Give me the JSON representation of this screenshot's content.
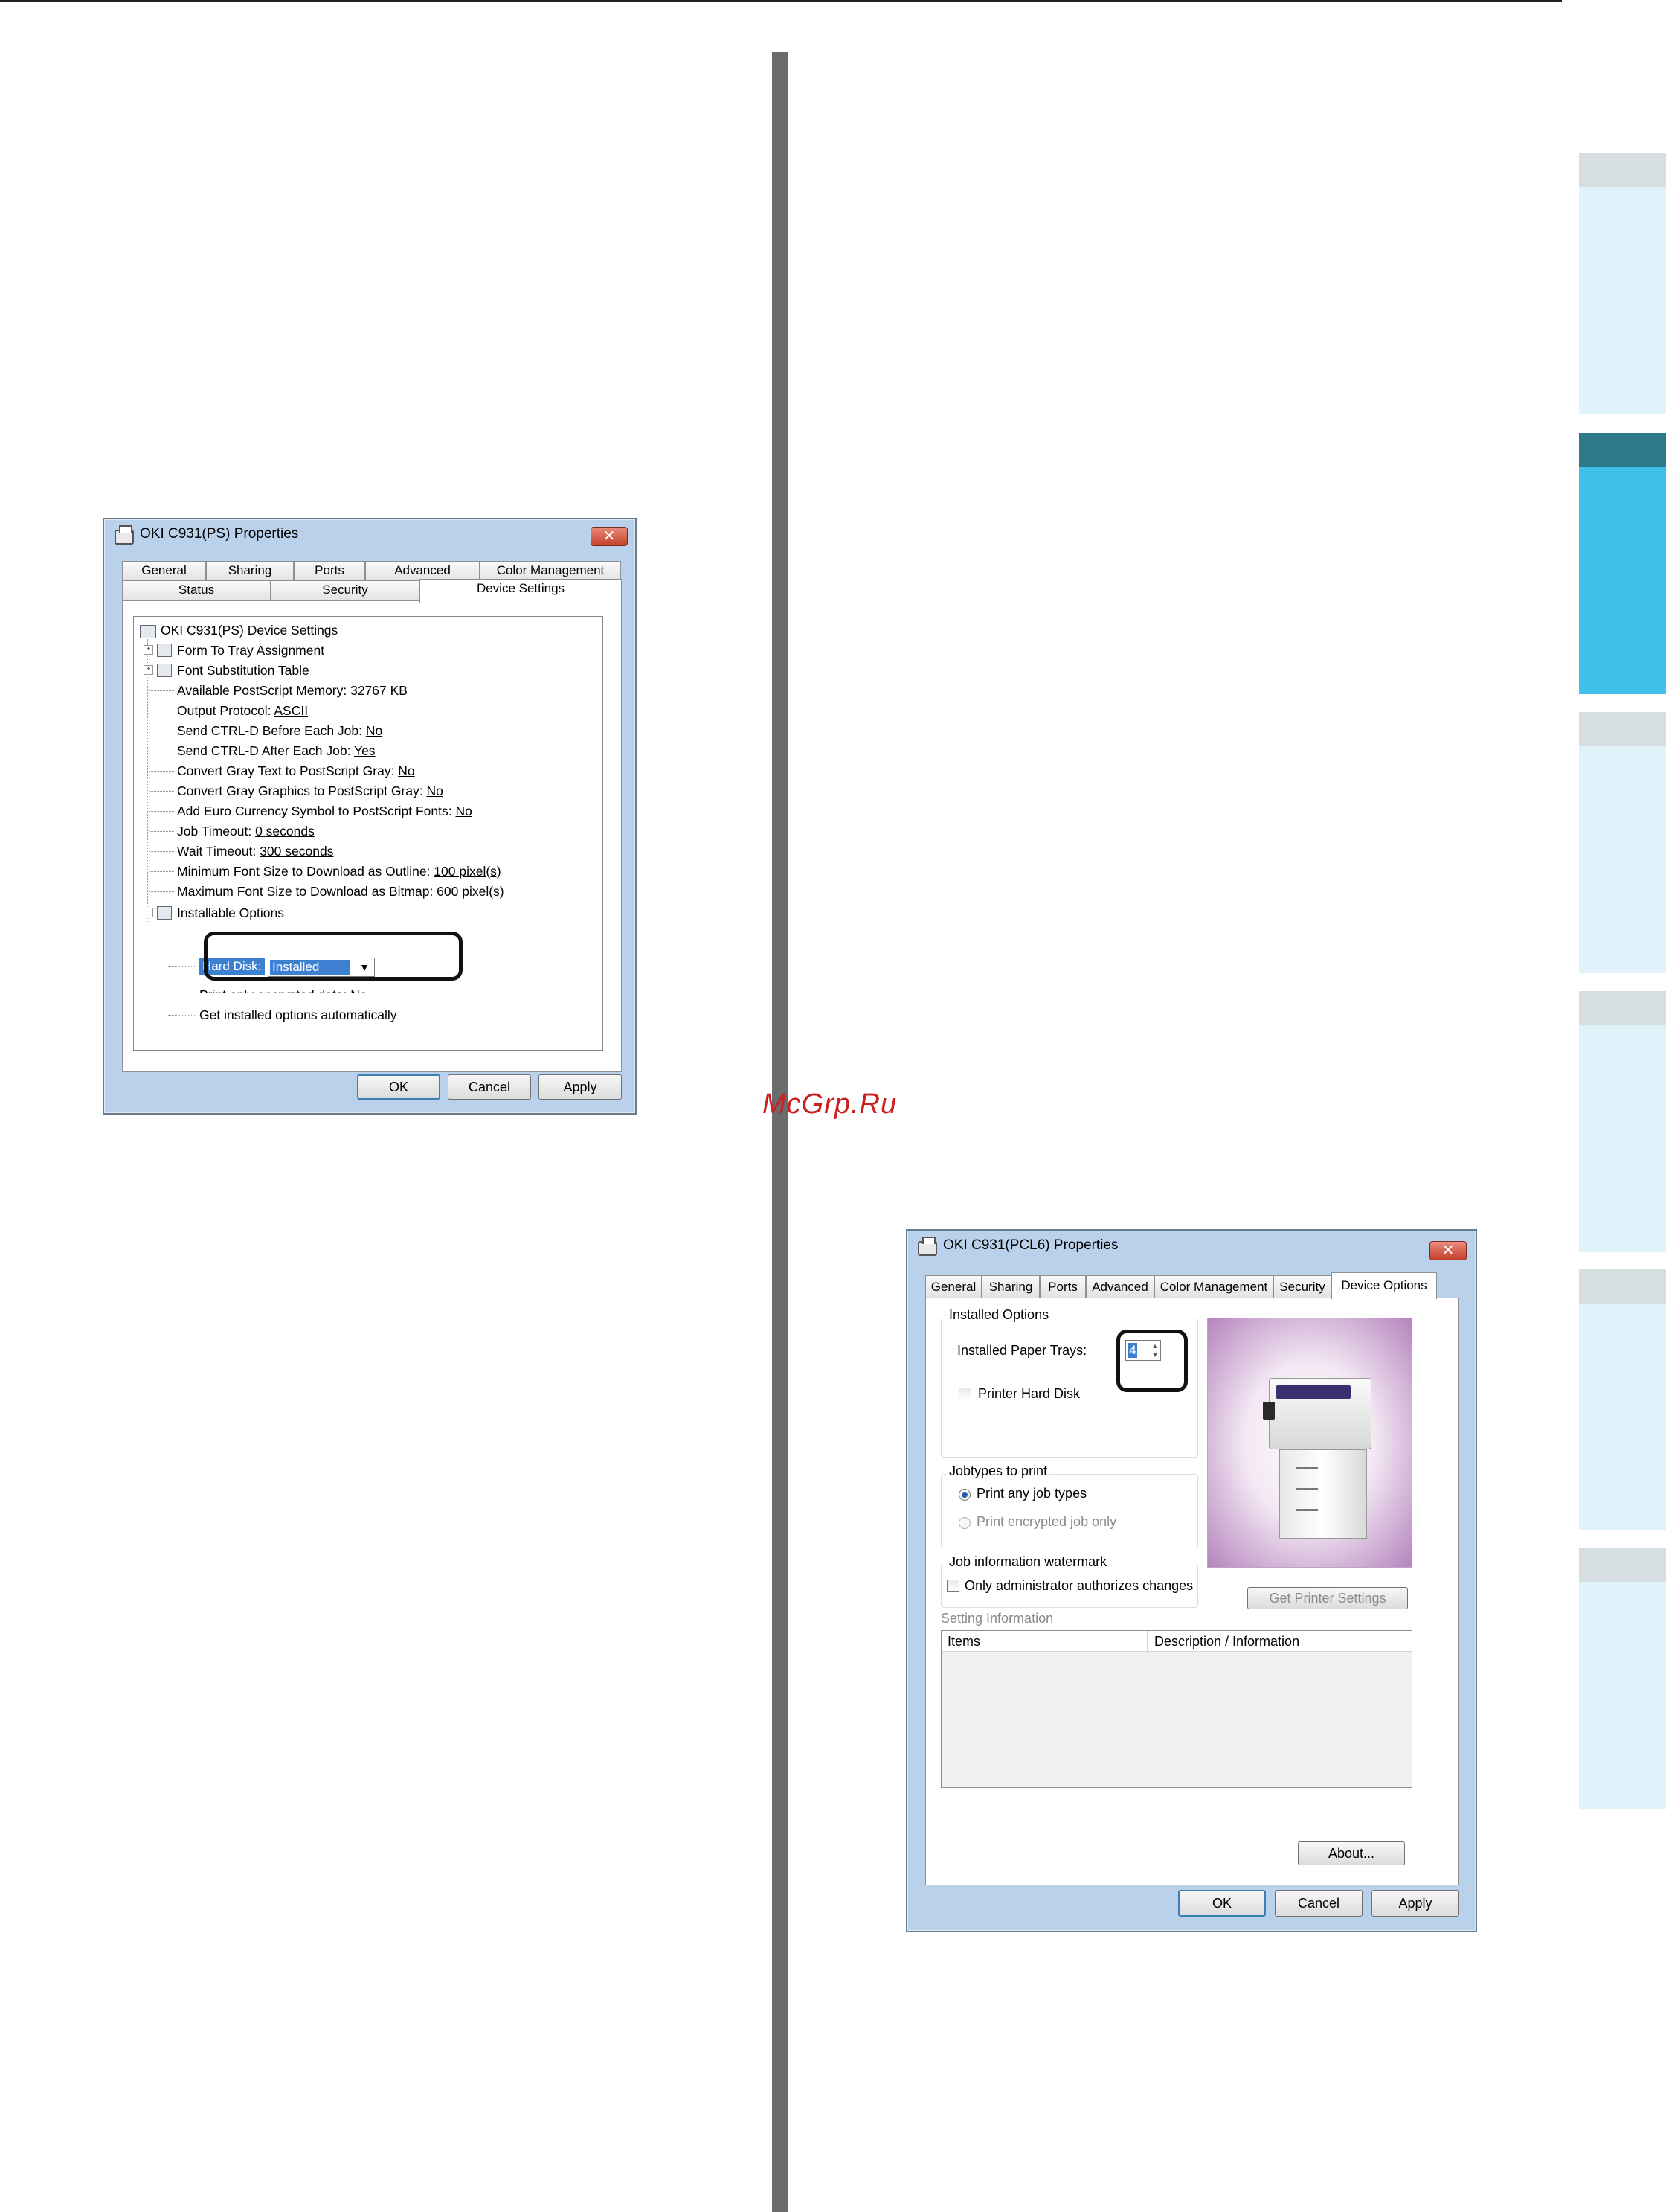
{
  "watermark": "McGrp.Ru",
  "ps_window": {
    "title": "OKI C931(PS) Properties",
    "close_glyph": "✕",
    "tabs_row1": [
      "General",
      "Sharing",
      "Ports",
      "Advanced",
      "Color Management"
    ],
    "tabs_row2": [
      "Status",
      "Security",
      "Device Settings"
    ],
    "selected_tab": "Device Settings",
    "tree": {
      "root": "OKI C931(PS) Device Settings",
      "items": [
        {
          "label": "Form To Tray Assignment",
          "value": ""
        },
        {
          "label": "Font Substitution Table",
          "value": ""
        },
        {
          "label": "Available PostScript Memory: ",
          "value": "32767 KB"
        },
        {
          "label": "Output Protocol: ",
          "value": "ASCII"
        },
        {
          "label": "Send CTRL-D Before Each Job: ",
          "value": "No"
        },
        {
          "label": "Send CTRL-D After Each Job: ",
          "value": "Yes"
        },
        {
          "label": "Convert Gray Text to PostScript Gray: ",
          "value": "No"
        },
        {
          "label": "Convert Gray Graphics to PostScript Gray: ",
          "value": "No"
        },
        {
          "label": "Add Euro Currency Symbol to PostScript Fonts: ",
          "value": "No"
        },
        {
          "label": "Job Timeout: ",
          "value": "0 seconds"
        },
        {
          "label": "Wait Timeout: ",
          "value": "300 seconds"
        },
        {
          "label": "Minimum Font Size to Download as Outline: ",
          "value": "100 pixel(s)"
        },
        {
          "label": "Maximum Font Size to Download as Bitmap: ",
          "value": "600 pixel(s)"
        }
      ],
      "installable_options": "Installable Options",
      "hard_disk_label": "Hard Disk:",
      "hard_disk_value": "Installed",
      "partial_line": "Print only encrypted data: No",
      "get_options": "Get installed options automatically"
    },
    "buttons": {
      "ok": "OK",
      "cancel": "Cancel",
      "apply": "Apply"
    }
  },
  "pcl_window": {
    "title": "OKI C931(PCL6) Properties",
    "close_glyph": "✕",
    "tabs": [
      "General",
      "Sharing",
      "Ports",
      "Advanced",
      "Color Management",
      "Security",
      "Device Options"
    ],
    "selected_tab": "Device Options",
    "installed_options": {
      "group_label": "Installed Options",
      "trays_label": "Installed Paper Trays:",
      "trays_value": "4",
      "hard_disk_label": "Printer Hard Disk"
    },
    "jobtypes": {
      "group_label": "Jobtypes to print",
      "option_any": "Print any job types",
      "option_encrypted": "Print encrypted job only"
    },
    "watermark_group": {
      "group_label": "Job information watermark",
      "checkbox_label": "Only administrator authorizes changes"
    },
    "get_settings_button": "Get Printer Settings",
    "setting_info_label": "Setting Information",
    "table_headers": [
      "Items",
      "Description / Information"
    ],
    "about_button": "About...",
    "buttons": {
      "ok": "OK",
      "cancel": "Cancel",
      "apply": "Apply"
    }
  }
}
